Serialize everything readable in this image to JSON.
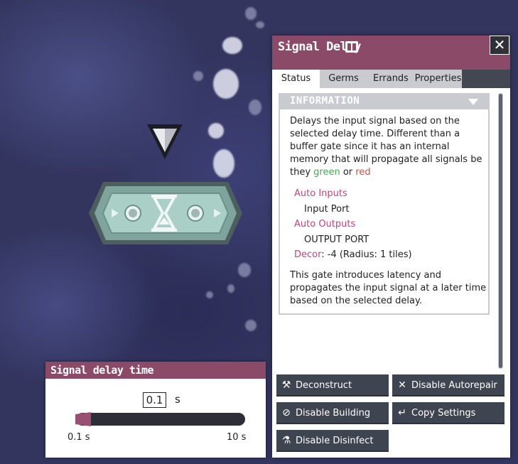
{
  "side_panel": {
    "title": "Signal Delay",
    "close_label": "✕",
    "tabs": [
      "Status",
      "Germs",
      "Errands",
      "Properties"
    ],
    "active_tab": "Status",
    "information": {
      "header": "INFORMATION",
      "description_part1": "Delays the input signal based on the selected delay time.  Different than a buffer gate since it has an internal memory that will propagate all signals be they ",
      "green_word": "green",
      "or_word": " or ",
      "red_word": "red",
      "auto_inputs_label": "Auto Inputs",
      "input_port": "Input Port",
      "auto_outputs_label": "Auto Outputs",
      "output_port": "OUTPUT PORT",
      "decor_label": "Decor",
      "decor_value": ": -4 (Radius: 1 tiles)",
      "extra_description": "This gate introduces latency and propagates the input signal at a later time based on the selected delay."
    },
    "buttons": {
      "deconstruct": "Deconstruct",
      "disable_autorepair": "Disable Autorepair",
      "disable_building": "Disable Building",
      "copy_settings": "Copy Settings",
      "disable_disinfect": "Disable Disinfect"
    }
  },
  "delay_screen": {
    "title": "Signal delay time",
    "value": "0.1",
    "unit": "s",
    "min_label": "0.1 s",
    "max_label": "10 s",
    "slider_fraction": 0.0
  },
  "colors": {
    "header_accent": "#8b4a68",
    "button_bg": "#3f4451",
    "link_pink": "#c2447b",
    "green": "#38b14c",
    "red": "#e04a3c"
  }
}
